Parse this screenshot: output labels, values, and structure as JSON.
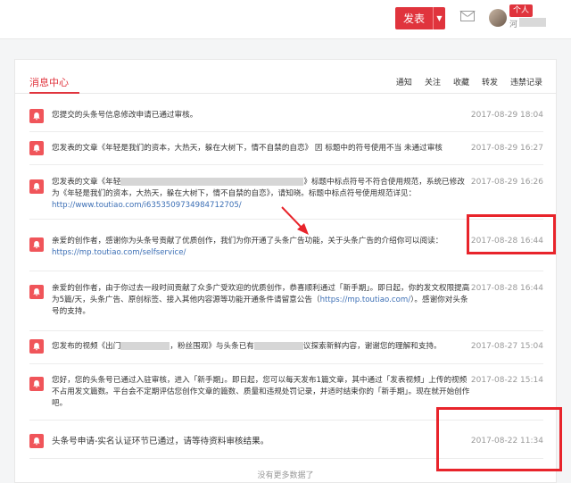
{
  "header": {
    "publish_label": "发表",
    "role_badge": "个人",
    "username": "河"
  },
  "panel": {
    "title": "消息中心",
    "tabs": [
      "通知",
      "关注",
      "收藏",
      "转发",
      "违禁记录"
    ],
    "footer": "没有更多数据了"
  },
  "messages": [
    {
      "text": "您提交的头条号信息修改申请已通过审核。",
      "time": "2017-08-29 18:04"
    },
    {
      "text": "您发表的文章《年轻是我们的资本，大热天，躲在大树下，情不自禁的自恋》 因 标题中的符号使用不当 未通过审核",
      "time": "2017-08-29 16:27"
    },
    {
      "text": "您发表的文章《年轻",
      "text2": "》标题中标点符号不符合使用规范，系统已修改为《年轻是我们的资本，大热天，躲在大树下，情不自禁的自恋》，请知晓。标题中标点符号使用规范详见：",
      "link": "http://www.toutiao.com/i6353509734984712705/",
      "time": "2017-08-29 16:26"
    },
    {
      "text": "亲爱的创作者，感谢你为头条号贡献了优质创作，我们为你开通了头条广告功能，关于头条广告的介绍你可以阅读：",
      "link": "https://mp.toutiao.com/selfservice/",
      "time": "2017-08-28 16:44"
    },
    {
      "text": "亲爱的创作者，由于你过去一段时间贡献了众多广受欢迎的优质创作，恭喜顺利通过「新手期」。即日起，你的发文权限提高为5篇/天，头条广告、原创标签、接入其他内容源等功能开通条件请留意公告（",
      "link": "https://mp.toutiao.com/",
      "text2": "）。感谢你对头条号的支持。",
      "time": "2017-08-28 16:44"
    },
    {
      "text": "您发布的视频《出门",
      "text2": "，粉丝围观》与头条已有",
      "text3": "议探索新鲜内容，谢谢您的理解和支持。",
      "time": "2017-08-27 15:04"
    },
    {
      "text": "您好，您的头条号已通过入驻审核，进入「新手期」。即日起，您可以每天发布1篇文章，其中通过「发表视频」上传的视频不占用发文篇数。平台会不定期评估您创作文章的篇数、质量和违规处罚记录，并适时结束你的「新手期」。现在就开始创作吧。",
      "time": "2017-08-22 15:14"
    },
    {
      "text": "头条号申请-实名认证环节已通过，请等待资料审核结果。",
      "time": "2017-08-22 11:34"
    }
  ],
  "colors": {
    "accent": "#e0343d",
    "link": "#3c6fb5",
    "annotation": "#e8242b"
  },
  "icons": [
    "bell-icon",
    "mail-icon",
    "caret-down-icon"
  ]
}
